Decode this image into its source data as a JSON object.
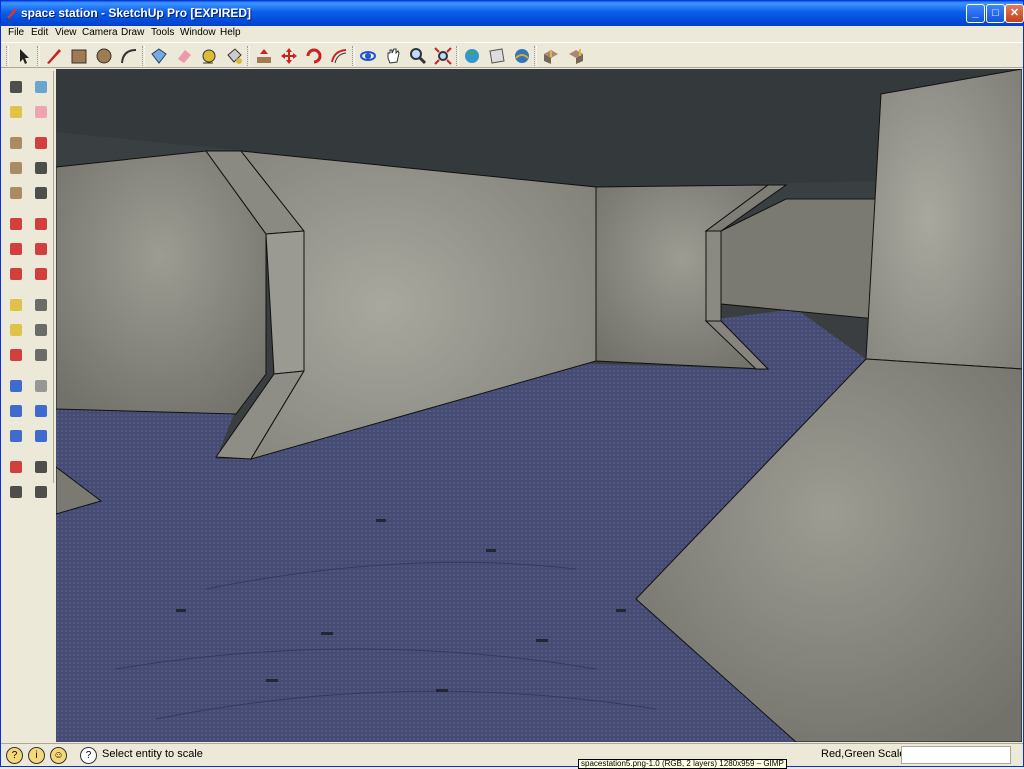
{
  "window": {
    "title": "space station - SketchUp Pro [EXPIRED]"
  },
  "menu": [
    "File",
    "Edit",
    "View",
    "Camera",
    "Draw",
    "Tools",
    "Window",
    "Help"
  ],
  "toolbar_icons": [
    "select-icon",
    "line-icon",
    "rectangle-icon",
    "circle-icon",
    "arc-icon",
    "make-component-icon",
    "eraser-icon",
    "tape-measure-icon",
    "paint-bucket-icon",
    "push-pull-icon",
    "move-icon",
    "rotate-icon",
    "offset-icon",
    "orbit-icon",
    "pan-icon",
    "zoom-icon",
    "zoom-extents-icon",
    "get-models-icon",
    "share-model-icon",
    "google-earth-icon",
    "get-components-icon",
    "share-component-icon"
  ],
  "left_toolbar_icons": [
    "select-icon",
    "make-component-icon",
    "paint-bucket-icon",
    "eraser-icon",
    "rectangle-icon",
    "line-icon",
    "circle-icon",
    "arc-icon",
    "polygon-icon",
    "freehand-icon",
    "move-icon",
    "push-pull-icon",
    "rotate-icon",
    "follow-me-icon",
    "scale-icon",
    "offset-icon",
    "tape-measure-icon",
    "dimension-icon",
    "protractor-icon",
    "text-icon",
    "axes-icon",
    "3d-text-icon",
    "orbit-icon",
    "pan-icon",
    "zoom-icon",
    "zoom-window-icon",
    "previous-view-icon",
    "next-view-icon",
    "position-camera-icon",
    "look-around-icon",
    "walk-icon",
    "section-plane-icon"
  ],
  "status": {
    "message": "Select entity to scale",
    "measurement_label": "Red,Green Scale",
    "measurement_value": ""
  },
  "tooltip": "spacestation5.png-1.0 (RGB, 2 layers) 1280x959 – GIMP",
  "colors": {
    "titlebar": "#0a5fe8",
    "ceiling": "#3a3f41",
    "wall": "#8b8b83",
    "floor": "#4a5078"
  }
}
